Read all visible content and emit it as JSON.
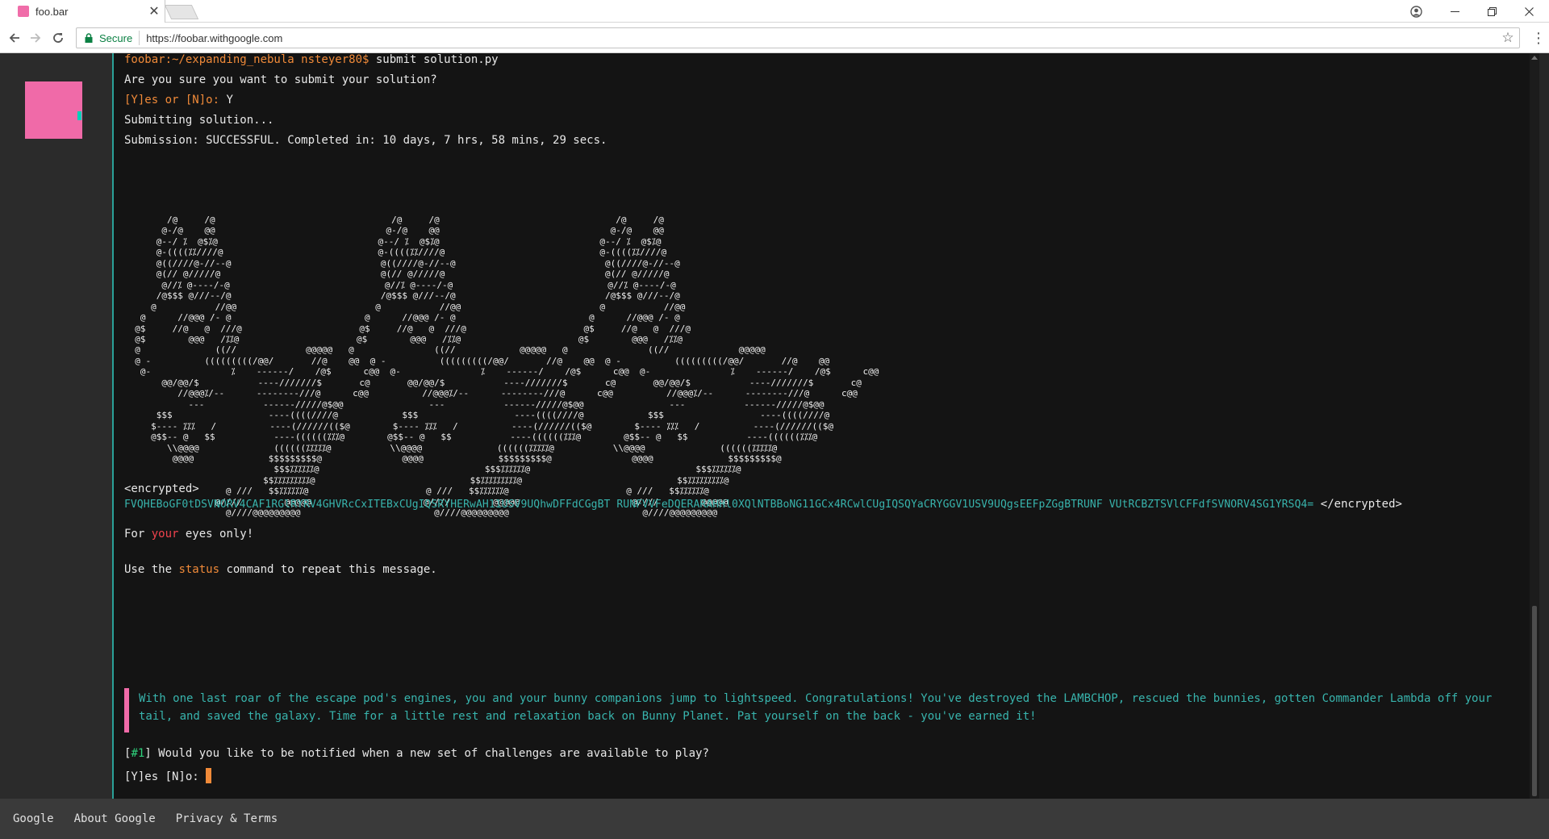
{
  "browser": {
    "tab_title": "foo.bar",
    "secure_label": "Secure",
    "url": "https://foobar.withgoogle.com"
  },
  "terminal": {
    "prompt": "foobar:~/expanding_nebula nsteyer80$",
    "command": " submit solution.py",
    "confirm_question": "Are you sure you want to submit your solution?",
    "confirm_options": "[Y]es or [N]o:",
    "confirm_answer": " Y",
    "submitting": "Submitting solution...",
    "submission_result": "Submission: SUCCESSFUL. Completed in: 10 days, 7 hrs, 58 mins, 29 secs.",
    "ascii_art": "        /@     /@                                 /@     /@                                 /@     /@\n       @-/@    @@                                @-/@    @@                                @-/@    @@\n      @--/ ⁒  @$⁒@                              @--/ ⁒  @$⁒@                              @--/ ⁒  @$⁒@\n      @-((((⁒⁒////@                             @-((((⁒⁒////@                             @-((((⁒⁒////@\n      @((////@-//--@                            @((////@-//--@                            @((////@-//--@\n      @(// @/////@                              @(// @/////@                              @(// @/////@\n       @//⁒ @----/-@                             @//⁒ @----/-@                             @//⁒ @----/-@\n      /@$$$ @///--/@                            /@$$$ @///--/@                            /@$$$ @///--/@\n     @           //@@                          @           //@@                          @           //@@\n   @      //@@@ /- @                         @      //@@@ /- @                         @      //@@@ /- @\n  @$     //@   @  ///@                      @$     //@   @  ///@                      @$     //@   @  ///@\n  @$        @@@   /⁒⁒@                      @$        @@@   /⁒⁒@                      @$        @@@   /⁒⁒@\n  @              ((//             @@@@@   @               ((//            @@@@@   @               ((//             @@@@@\n  @ -          (((((((((/@@/       //@    @@  @ -          (((((((((/@@/       //@    @@  @ -          (((((((((/@@/       //@    @@\n   @-               ⁒    ------/    /@$      c@@  @-               ⁒    ------/    /@$      c@@  @-               ⁒    ------/    /@$      c@@\n       @@/@@/$           ----///////$       c@       @@/@@/$           ----///////$       c@       @@/@@/$           ----///////$       c@\n          //@@@⁒/--      --------///@      c@@          //@@@⁒/--      --------///@      c@@          //@@@⁒/--      --------///@      c@@\n            ---           ------/////@$@@                ---           ------/////@$@@                ---           ------/////@$@@\n      $$$                  ----((((////@            $$$                  ----((((////@            $$$                  ----((((////@\n     $---- ⁒⁒⁒   /          ----(//////(($@        $---- ⁒⁒⁒   /          ----(//////(($@        $---- ⁒⁒⁒   /          ----(//////(($@\n     @$$-- @   $$           ----((((((⁒⁒⁒@        @$$-- @   $$           ----((((((⁒⁒⁒@        @$$-- @   $$           ----((((((⁒⁒⁒@\n        \\\\@@@@              ((((((⁒⁒⁒⁒⁒@           \\\\@@@@              ((((((⁒⁒⁒⁒⁒@           \\\\@@@@              ((((((⁒⁒⁒⁒⁒@\n         @@@@              $$$$$$$$$@               @@@@              $$$$$$$$$@               @@@@              $$$$$$$$$@\n                            $$$⁒⁒⁒⁒⁒⁒@                               $$$⁒⁒⁒⁒⁒⁒@                               $$$⁒⁒⁒⁒⁒⁒@\n                          $$⁒⁒⁒⁒⁒⁒⁒⁒⁒@                             $$⁒⁒⁒⁒⁒⁒⁒⁒⁒@                             $$⁒⁒⁒⁒⁒⁒⁒⁒⁒@\n                   @ ///   $$⁒⁒⁒⁒⁒⁒@                      @ ///   $$⁒⁒⁒⁒⁒⁒@                      @ ///   $$⁒⁒⁒⁒⁒⁒@\n                 @////        @@@@@                     @////        @@@@@                     @////        @@@@@\n                   @////@@@@@@@@@                         @////@@@@@@@@@                         @////@@@@@@@@@",
    "encrypted_open": "<encrypted>",
    "encrypted_text": "FVQHEBoGF0tDSVNORV4CAF1RGlRYRV4GHVRcCxITEBxCUgIQSRYHERwAH11USV9UQhwDFFdCGgBT RUNFVVFeDQERARAHHl0XQlNTBBoNG11GCx4RCwlCUgIQSQYaCRYGGV1USV9UQgsEEFpZGgBTRUNF VUtRCBZTSVlCFFdfSVNORV4SG1YRSQ4=",
    "encrypted_close": " </encrypted>",
    "eyes_pre": "For ",
    "eyes_highlight": "your",
    "eyes_post": " eyes only!",
    "status_pre": "Use the ",
    "status_cmd": "status",
    "status_post": " command to repeat this message.",
    "quote": "With one last roar of the escape pod's engines, you and your bunny companions jump to lightspeed. Congratulations! You've destroyed the LAMBCHOP, rescued the bunnies, gotten Commander Lambda off your tail, and saved the galaxy. Time for a little rest and relaxation back on Bunny Planet. Pat yourself on the back - you've earned it!",
    "notify_open": "[",
    "notify_tag": "#1",
    "notify_close": "]",
    "notify_question": " Would you like to be notified when a new set of challenges are available to play?",
    "final_prompt": "[Y]es [N]o: "
  },
  "footer": {
    "links": [
      "Google",
      "About Google",
      "Privacy & Terms"
    ]
  },
  "colors": {
    "accent_pink": "#f06aa8",
    "prompt_orange": "#f08a39",
    "teal": "#2aa6a0",
    "highlight_red": "#f0424d"
  }
}
